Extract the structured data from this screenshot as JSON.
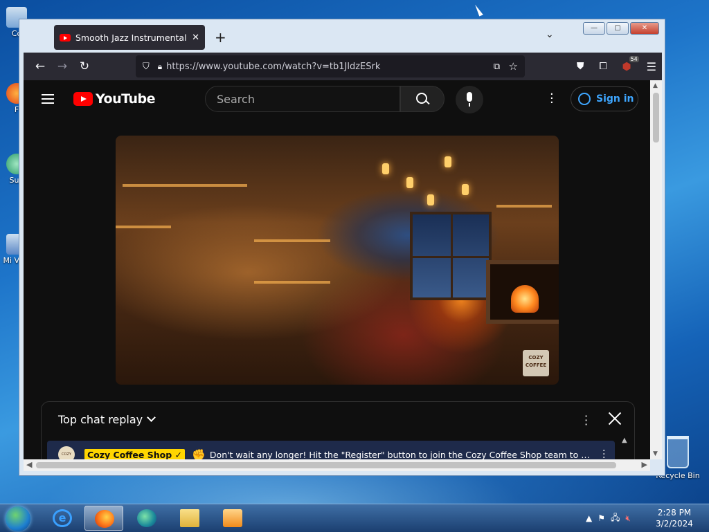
{
  "desktop": {
    "icons": [
      {
        "label": "Co"
      },
      {
        "label": "F"
      },
      {
        "label": "Sup"
      },
      {
        "label": "Mi Visu"
      }
    ],
    "recycle_bin_label": "Recycle Bin"
  },
  "browser": {
    "tab": {
      "title": "Smooth Jazz Instrumental Music",
      "close": "✕"
    },
    "new_tab": "+",
    "list_tabs": "⌄",
    "window_controls": {
      "minimize": "—",
      "maximize": "▢",
      "close": "✕"
    },
    "nav": {
      "back": "←",
      "forward": "→",
      "reload": "↻"
    },
    "url": "https://www.youtube.com/watch?v=tb1JldzESrk",
    "extension_badge": "54",
    "icons": [
      "shield-icon",
      "lock-icon",
      "picture-in-picture-icon",
      "bookmark-star-icon",
      "pocket-icon",
      "extensions-icon",
      "ublock-icon",
      "menu-icon"
    ]
  },
  "youtube": {
    "logo_text": "YouTube",
    "search_placeholder": "Search",
    "sign_in": "Sign in",
    "video_watermark": "COZY COFFEE",
    "chat": {
      "title": "Top chat replay",
      "message": {
        "avatar_text": "COZY",
        "author": "Cozy Coffee Shop ✓",
        "emoji": "✊",
        "text": "Don't wait any longer! Hit the \"Register\" button to join the Cozy Coffee Shop team to be a part o..."
      }
    }
  },
  "taskbar": {
    "apps": [
      "internet-explorer",
      "firefox",
      "edge",
      "file-explorer",
      "media-player"
    ],
    "active_app": "firefox",
    "time": "2:28 PM",
    "date": "3/2/2024"
  },
  "colors": {
    "youtube_red": "#ff0000",
    "signin_blue": "#3ea6ff",
    "author_badge": "#ffd600",
    "browser_chrome": "#2b2a33"
  }
}
